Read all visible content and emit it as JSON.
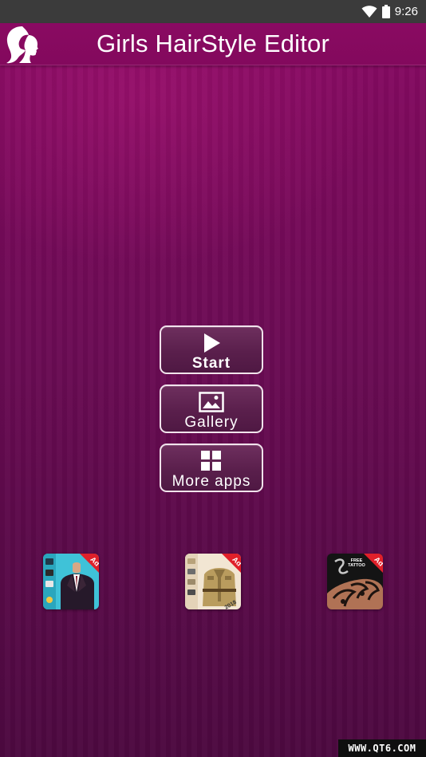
{
  "status_bar": {
    "time": "9:26",
    "icons": [
      "wifi-icon",
      "battery-icon"
    ]
  },
  "header": {
    "title": "Girls HairStyle Editor",
    "logo_icon": "girl-silhouette-icon"
  },
  "menu": {
    "start": {
      "label": "Start",
      "icon": "play-icon"
    },
    "gallery": {
      "label": "Gallery",
      "icon": "image-icon"
    },
    "more_apps": {
      "label": "More apps",
      "icon": "grid-icon"
    }
  },
  "ads": [
    {
      "badge": "Ad",
      "icon": "man-suit-app-icon"
    },
    {
      "badge": "Ad",
      "icon": "police-suit-app-icon",
      "caption": "2018"
    },
    {
      "badge": "Ad",
      "icon": "tattoo-app-icon",
      "caption": "FREE TATTOO"
    }
  ],
  "watermark": "WWW.QT6.COM",
  "colors": {
    "status_bar": "#3b3b3b",
    "title_bar": "#8a0a62",
    "background_top": "#8d0a66",
    "background_bottom": "#4d0940",
    "button_border": "#f1e3ec",
    "ad_badge": "#e0202a"
  }
}
